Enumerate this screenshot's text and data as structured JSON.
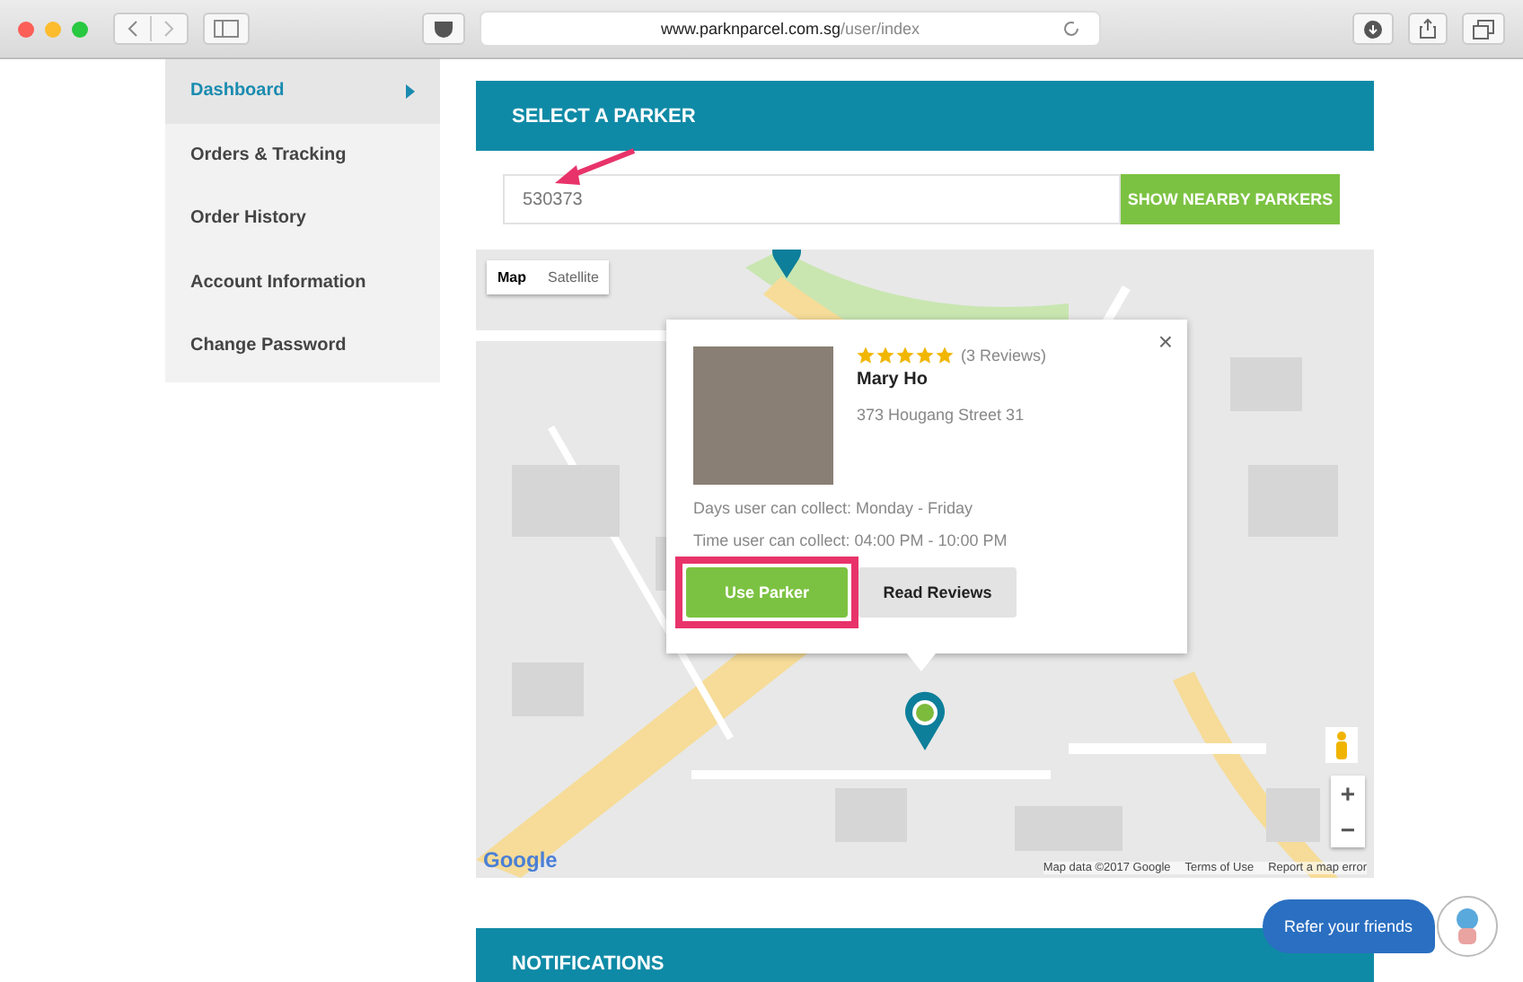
{
  "browser": {
    "url_domain": "www.parknparcel.com.sg",
    "url_path": "/user/index"
  },
  "sidebar": {
    "items": [
      {
        "label": "Dashboard",
        "selected": true
      },
      {
        "label": "Orders & Tracking",
        "selected": false
      },
      {
        "label": "Order History",
        "selected": false
      },
      {
        "label": "Account Information",
        "selected": false
      },
      {
        "label": "Change Password",
        "selected": false
      }
    ]
  },
  "parker_panel": {
    "title": "SELECT A PARKER",
    "search": {
      "value": "530373"
    },
    "search_button": "SHOW NEARBY PARKERS",
    "map": {
      "map_types": [
        {
          "label": "Map",
          "selected": true
        },
        {
          "label": "Satellite",
          "selected": false
        }
      ],
      "logo": "Google",
      "attribution": "Map data ©2017 Google",
      "terms": "Terms of Use",
      "report": "Report a map error",
      "zoom_in": "+",
      "zoom_out": "−",
      "popup": {
        "close": "×",
        "stars": 5,
        "reviews": "(3 Reviews)",
        "name": "Mary Ho",
        "address": "373 Hougang Street 31",
        "days": "Days user can collect: Monday - Friday",
        "time": "Time user can collect: 04:00 PM - 10:00 PM",
        "buttons": [
          {
            "label": "Use Parker",
            "kind": "primary",
            "highlighted": true
          },
          {
            "label": "Read Reviews",
            "kind": "secondary",
            "highlighted": false
          }
        ]
      }
    }
  },
  "notifications": {
    "title": "NOTIFICATIONS"
  },
  "refer": {
    "label": "Refer your friends"
  }
}
